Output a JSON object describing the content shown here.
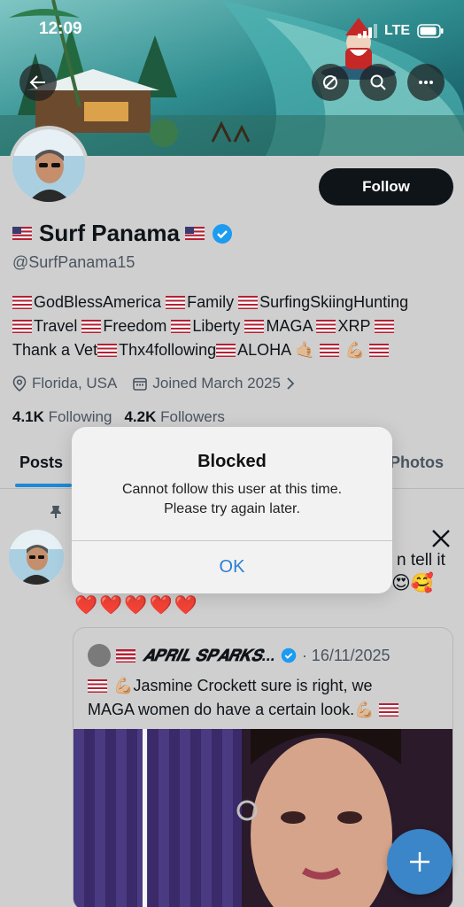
{
  "status_bar": {
    "time": "12:09",
    "network": "LTE"
  },
  "header": {
    "back_icon": "back-arrow-icon",
    "actions": [
      "ban-icon",
      "search-icon",
      "more-icon"
    ]
  },
  "profile": {
    "follow_label": "Follow",
    "name": "Surf Panama",
    "handle": "@SurfPanama15",
    "bio_lines": [
      "GodBlessAmerica Family SurfingSkiingHunting",
      "Travel Freedom Liberty MAGA XRP",
      "Thank a Vet Thx4following ALOHA"
    ],
    "bio_segments": {
      "l1": [
        "GodBlessAmerica",
        "Family",
        "SurfingSkiingHunting"
      ],
      "l2": [
        "Travel",
        "Freedom",
        "Liberty",
        "MAGA",
        "XRP"
      ],
      "l3": [
        "Thank a Vet",
        "Thx4following",
        "ALOHA"
      ]
    },
    "location": "Florida, USA",
    "joined": "Joined March 2025",
    "following_count": "4.1K",
    "following_label": "Following",
    "followers_count": "4.2K",
    "followers_label": "Followers"
  },
  "tabs": {
    "posts": "Posts",
    "photos": "Photos"
  },
  "post": {
    "text_visible": "n tell it",
    "hearts": "❤️❤️❤️❤️❤️",
    "quoted": {
      "author": "𝑨𝑷𝑹𝑰𝑳 𝑺𝑷𝑨𝑹𝑲𝑺...",
      "date": "· 16/11/2025",
      "text_line1": "Jasmine Crockett sure is right, we",
      "text_line2": "MAGA women do have a certain look."
    }
  },
  "dialog": {
    "title": "Blocked",
    "message_line1": "Cannot follow this user at this time.",
    "message_line2": "Please try again later.",
    "ok_label": "OK"
  },
  "colors": {
    "accent": "#1d9bf0",
    "follow_bg": "#0f1419",
    "dialog_ok": "#2a7fd4",
    "fab": "#3b86c8"
  }
}
